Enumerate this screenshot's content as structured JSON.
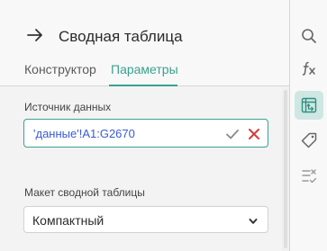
{
  "panel": {
    "title": "Сводная таблица",
    "tabs": [
      {
        "label": "Конструктор",
        "active": false
      },
      {
        "label": "Параметры",
        "active": true
      }
    ]
  },
  "params": {
    "source_label": "Источник данных",
    "source_value": "'данные'!A1:G2670",
    "layout_label": "Макет сводной таблицы",
    "layout_value": "Компактный"
  },
  "rightbar": {
    "items": [
      "search-icon",
      "function-icon",
      "pivot-table-icon",
      "tag-icon",
      "checklist-icon"
    ],
    "active": "pivot-table-icon"
  },
  "colors": {
    "accent": "#3aa18f",
    "range_text": "#3b5bd6",
    "cancel": "#d93a3a"
  }
}
